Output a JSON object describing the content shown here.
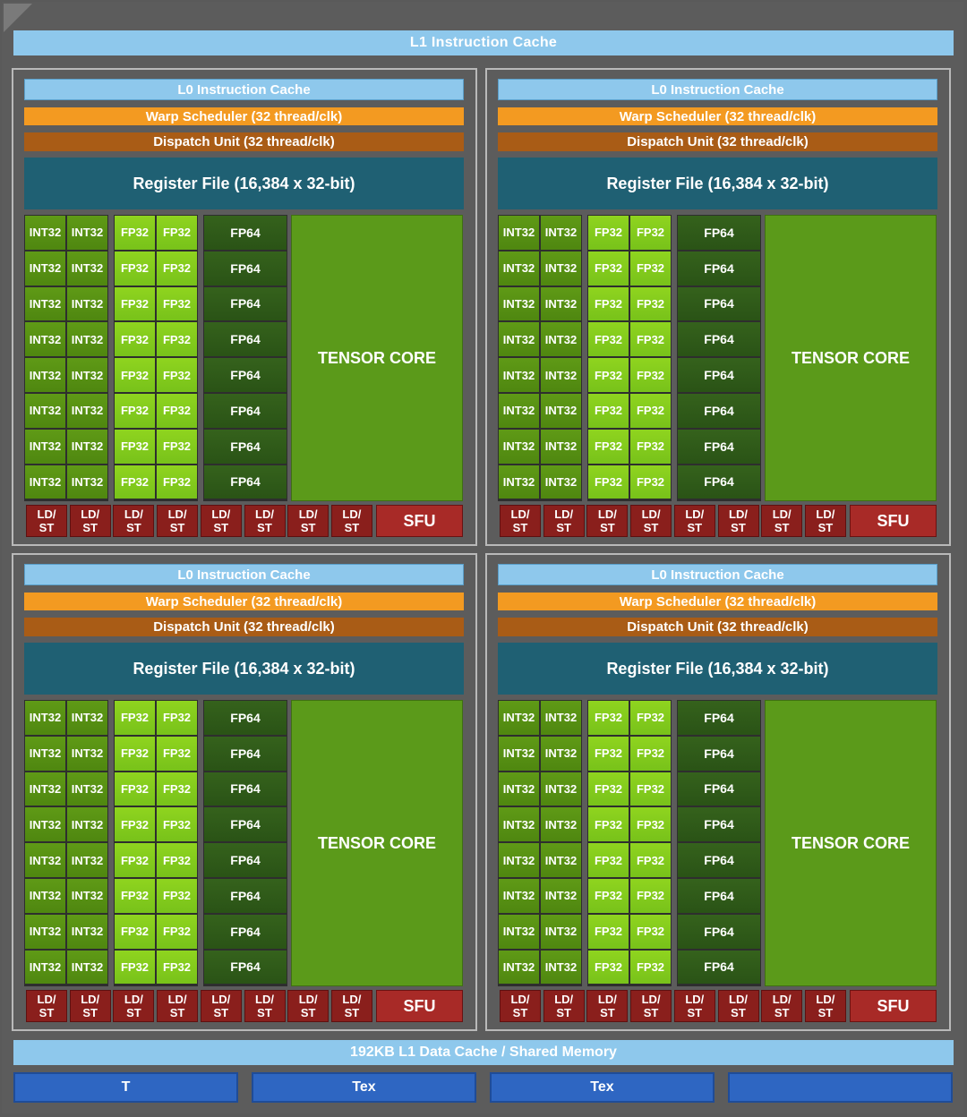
{
  "l1_instruction_cache": "L1 Instruction Cache",
  "sm": {
    "l0_cache": "L0 Instruction Cache",
    "warp_scheduler": "Warp Scheduler (32 thread/clk)",
    "dispatch_unit": "Dispatch Unit (32 thread/clk)",
    "register_file": "Register File (16,384 x 32-bit)",
    "int32": "INT32",
    "fp32": "FP32",
    "fp64": "FP64",
    "tensor_core": "TENSOR CORE",
    "ldst": "LD/\nST",
    "sfu": "SFU"
  },
  "l1_data_cache": "192KB L1 Data Cache / Shared Memory",
  "tex_units": [
    "T",
    "Tex",
    "Tex",
    ""
  ],
  "colors": {
    "cache": "#8ec8ec",
    "warp": "#f39a21",
    "dispatch": "#a95c16",
    "register": "#1f6073",
    "int32": "#5f9a16",
    "fp32": "#8fd41f",
    "fp64": "#35621c",
    "tensor": "#5b9a1a",
    "ldst": "#8a1f1c",
    "sfu": "#a82a27",
    "tex": "#2e66c2"
  }
}
